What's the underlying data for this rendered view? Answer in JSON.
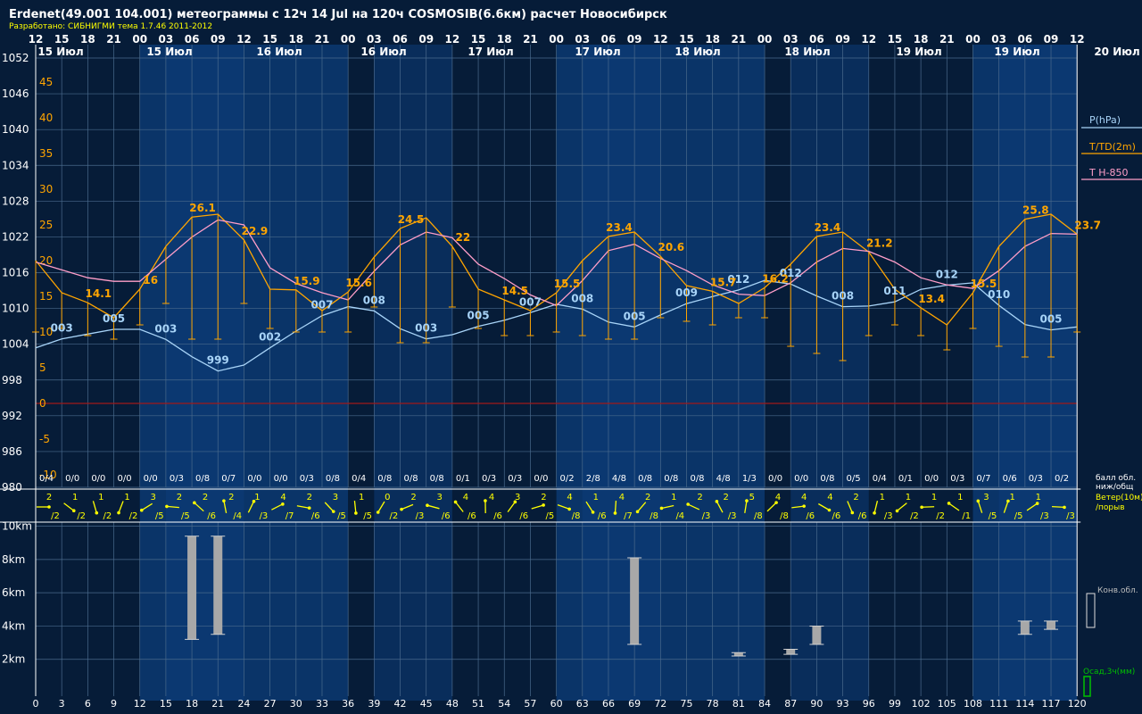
{
  "header": {
    "title": "Erdenet(49.001 104.001) метеограммы с  12ч 14 Jul на 120ч COSMOSIB(6.6км) расчет Новосибирск",
    "credit": "Разработано: СИБНИГМИ тема 1.7.46 2011-2012"
  },
  "colors": {
    "background": "#061c38",
    "band_dark": "#061c38",
    "band_light": "#0a3468",
    "grid": "#4a6a8c",
    "title": "#ffffff",
    "credit": "#ffff00",
    "pressure": "#a8d4f8",
    "temperature": "#ffa500",
    "t850": "#ff9ec8",
    "wind": "#ffff00",
    "convective_cloud": "#a8a8a8",
    "precip": "#00c000",
    "zero_line": "#a01818"
  },
  "time_axis": {
    "top_hours": [
      "12",
      "15",
      "18",
      "21",
      "00",
      "03",
      "06",
      "09",
      "12",
      "15",
      "18",
      "21",
      "00",
      "03",
      "06",
      "09",
      "12",
      "15",
      "18",
      "21",
      "00",
      "03",
      "06",
      "09",
      "12",
      "15",
      "18",
      "21",
      "00",
      "03",
      "06",
      "09",
      "12",
      "15",
      "18",
      "21",
      "00",
      "03",
      "06",
      "09",
      "12"
    ],
    "date_labels": [
      "15 Июл",
      "15 Июл",
      "16 Июл",
      "16 Июл",
      "17 Июл",
      "17 Июл",
      "18 Июл",
      "18 Июл",
      "19 Июл",
      "19 Июл",
      "20 Июл"
    ],
    "bottom_hours": [
      "0",
      "3",
      "6",
      "9",
      "12",
      "15",
      "18",
      "21",
      "24",
      "27",
      "30",
      "33",
      "36",
      "39",
      "42",
      "45",
      "48",
      "51",
      "54",
      "57",
      "60",
      "63",
      "66",
      "69",
      "72",
      "75",
      "78",
      "81",
      "84",
      "87",
      "90",
      "93",
      "96",
      "99",
      "102",
      "105",
      "108",
      "111",
      "114",
      "117",
      "120"
    ]
  },
  "y_axes": {
    "pressure_ticks": [
      "1052",
      "1046",
      "1040",
      "1034",
      "1028",
      "1022",
      "1016",
      "1010",
      "1004",
      "998",
      "992",
      "986",
      "980"
    ],
    "temperature_ticks": [
      "45",
      "40",
      "35",
      "30",
      "25",
      "20",
      "15",
      "10",
      "5",
      "0",
      "-5",
      "-10"
    ],
    "height_ticks": [
      "10km",
      "8km",
      "6km",
      "4km",
      "2km"
    ]
  },
  "legend": {
    "pressure": "P(hPa)",
    "temperature": "T/TD(2m)",
    "t850": "T H-850",
    "cloud_label_1": "балл обл.",
    "cloud_label_2": "ниж/общ",
    "wind_label_1": "Ветер(10м)",
    "wind_label_2": "/порыв",
    "convective": "Конв.обл.",
    "precip": "Осад,3ч(мм)"
  },
  "cloud_cover": [
    "0/4",
    "0/0",
    "0/0",
    "0/0",
    "0/0",
    "0/3",
    "0/8",
    "0/7",
    "0/0",
    "0/0",
    "0/3",
    "0/8",
    "0/4",
    "0/8",
    "0/8",
    "0/8",
    "0/1",
    "0/3",
    "0/3",
    "0/0",
    "0/2",
    "2/8",
    "4/8",
    "0/8",
    "0/8",
    "0/8",
    "4/8",
    "1/3",
    "0/0",
    "0/0",
    "0/8",
    "0/5",
    "0/4",
    "0/1",
    "0/0",
    "0/3",
    "0/7",
    "0/6",
    "0/3",
    "0/2"
  ],
  "wind": {
    "speeds": [
      "2",
      "1",
      "1",
      "1",
      "3",
      "2",
      "2",
      "2",
      "1",
      "4",
      "2",
      "3",
      "1",
      "0",
      "2",
      "3",
      "4",
      "4",
      "3",
      "2",
      "4",
      "1",
      "4",
      "2",
      "1",
      "2",
      "2",
      "5",
      "4",
      "4",
      "4",
      "2",
      "1",
      "1",
      "1",
      "1",
      "3",
      "1",
      "1"
    ],
    "gusts": [
      "/2",
      "/2",
      "/2",
      "/2",
      "/5",
      "/5",
      "/6",
      "/4",
      "/3",
      "/7",
      "/6",
      "/5",
      "/5",
      "/2",
      "/3",
      "/6",
      "/6",
      "/6",
      "/6",
      "/5",
      "/8",
      "/6",
      "/7",
      "/8",
      "/4",
      "/3",
      "/3",
      "/8",
      "/8",
      "/6",
      "/6",
      "/6",
      "/3",
      "/2",
      "/2",
      "/1",
      "/5",
      "/5",
      "/3",
      "/3"
    ]
  },
  "chart_data": {
    "type": "line",
    "x_hours": [
      0,
      3,
      6,
      9,
      12,
      15,
      18,
      21,
      24,
      27,
      30,
      33,
      36,
      39,
      42,
      45,
      48,
      51,
      54,
      57,
      60,
      63,
      66,
      69,
      72,
      75,
      78,
      81,
      84,
      87,
      90,
      93,
      96,
      99,
      102,
      105,
      108,
      111,
      114,
      117,
      120
    ],
    "series": [
      {
        "name": "P(hPa)",
        "axis": "pressure",
        "values": [
          1003.4,
          1004.9,
          1005.7,
          1006.5,
          1006.5,
          1004.8,
          1001.9,
          999.5,
          1000.5,
          1003.4,
          1006.2,
          1008.8,
          1010.3,
          1009.6,
          1006.6,
          1004.9,
          1005.6,
          1007.0,
          1008.0,
          1009.3,
          1010.7,
          1009.9,
          1007.7,
          1006.9,
          1008.9,
          1010.8,
          1012.0,
          1013.1,
          1014.7,
          1014.1,
          1012.1,
          1010.3,
          1010.4,
          1011.1,
          1013.2,
          1013.9,
          1014.3,
          1010.5,
          1007.3,
          1006.4,
          1006.9
        ]
      },
      {
        "name": "T/TD(2m)",
        "axis": "temperature",
        "values": [
          20,
          15.5,
          14.1,
          12,
          16,
          22,
          26.1,
          26.5,
          22.9,
          16,
          15.9,
          13,
          15.6,
          20.5,
          24.5,
          26,
          22,
          16,
          14.5,
          13,
          15.5,
          20,
          23.4,
          24,
          20.6,
          16.5,
          15.7,
          14,
          16.2,
          19.5,
          23.4,
          24,
          21.2,
          16,
          13.4,
          11,
          15.5,
          22,
          25.8,
          26.5,
          23.7
        ]
      },
      {
        "name": "T H-850",
        "axis": "temperature",
        "values": [
          19.8,
          18.7,
          17.6,
          17.1,
          17.1,
          20.2,
          23.3,
          25.7,
          25.0,
          19.0,
          16.8,
          15.5,
          14.5,
          18.5,
          22.2,
          24.0,
          23.2,
          19.5,
          17.5,
          15.2,
          13.7,
          17.2,
          21.4,
          22.3,
          20.3,
          18.6,
          16.6,
          15.3,
          15.1,
          16.9,
          19.8,
          21.7,
          21.3,
          19.8,
          17.6,
          16.6,
          16.1,
          18.6,
          22.0,
          23.8,
          23.7
        ]
      }
    ],
    "dewpoint_whiskers": [
      {
        "hour": 0,
        "t": 20,
        "td": 10
      },
      {
        "hour": 3,
        "t": 15.5,
        "td": 10.5
      },
      {
        "hour": 6,
        "t": 14.1,
        "td": 9.5
      },
      {
        "hour": 9,
        "t": 12,
        "td": 9
      },
      {
        "hour": 12,
        "t": 16,
        "td": 11
      },
      {
        "hour": 15,
        "t": 22,
        "td": 14
      },
      {
        "hour": 18,
        "t": 26.1,
        "td": 9
      },
      {
        "hour": 21,
        "t": 26.5,
        "td": 9
      },
      {
        "hour": 24,
        "t": 22.9,
        "td": 14
      },
      {
        "hour": 27,
        "t": 16,
        "td": 10.5
      },
      {
        "hour": 30,
        "t": 15.9,
        "td": 10
      },
      {
        "hour": 33,
        "t": 13,
        "td": 10
      },
      {
        "hour": 36,
        "t": 15.6,
        "td": 10
      },
      {
        "hour": 39,
        "t": 20.5,
        "td": 13.5
      },
      {
        "hour": 42,
        "t": 24.5,
        "td": 8.5
      },
      {
        "hour": 45,
        "t": 26,
        "td": 8.5
      },
      {
        "hour": 48,
        "t": 22,
        "td": 13.5
      },
      {
        "hour": 51,
        "t": 16,
        "td": 10.5
      },
      {
        "hour": 54,
        "t": 14.5,
        "td": 9.5
      },
      {
        "hour": 57,
        "t": 13,
        "td": 9.5
      },
      {
        "hour": 60,
        "t": 15.5,
        "td": 10
      },
      {
        "hour": 63,
        "t": 20,
        "td": 9.5
      },
      {
        "hour": 66,
        "t": 23.4,
        "td": 9
      },
      {
        "hour": 69,
        "t": 24,
        "td": 9
      },
      {
        "hour": 72,
        "t": 20.6,
        "td": 12
      },
      {
        "hour": 75,
        "t": 16.5,
        "td": 11.5
      },
      {
        "hour": 78,
        "t": 15.7,
        "td": 11
      },
      {
        "hour": 81,
        "t": 14,
        "td": 12
      },
      {
        "hour": 84,
        "t": 16.2,
        "td": 12
      },
      {
        "hour": 87,
        "t": 19.5,
        "td": 8
      },
      {
        "hour": 90,
        "t": 23.4,
        "td": 7
      },
      {
        "hour": 93,
        "t": 24,
        "td": 6
      },
      {
        "hour": 96,
        "t": 21.2,
        "td": 9.5
      },
      {
        "hour": 99,
        "t": 16,
        "td": 11
      },
      {
        "hour": 102,
        "t": 13.4,
        "td": 9.5
      },
      {
        "hour": 105,
        "t": 11,
        "td": 7.5
      },
      {
        "hour": 108,
        "t": 15.5,
        "td": 10.5
      },
      {
        "hour": 111,
        "t": 22,
        "td": 8
      },
      {
        "hour": 114,
        "t": 25.8,
        "td": 6.5
      },
      {
        "hour": 117,
        "t": 26.5,
        "td": 6.5
      },
      {
        "hour": 120,
        "t": 23.7,
        "td": 10
      }
    ],
    "pressure_labels": [
      {
        "hour": 3,
        "text": "003"
      },
      {
        "hour": 9,
        "text": "005"
      },
      {
        "hour": 15,
        "text": "003"
      },
      {
        "hour": 21,
        "text": "999"
      },
      {
        "hour": 27,
        "text": "002"
      },
      {
        "hour": 33,
        "text": "007"
      },
      {
        "hour": 39,
        "text": "008"
      },
      {
        "hour": 45,
        "text": "003"
      },
      {
        "hour": 51,
        "text": "005"
      },
      {
        "hour": 57,
        "text": "007"
      },
      {
        "hour": 63,
        "text": "008"
      },
      {
        "hour": 69,
        "text": "005"
      },
      {
        "hour": 75,
        "text": "009"
      },
      {
        "hour": 81,
        "text": "012"
      },
      {
        "hour": 87,
        "text": "012"
      },
      {
        "hour": 93,
        "text": "008"
      },
      {
        "hour": 99,
        "text": "011"
      },
      {
        "hour": 105,
        "text": "012"
      },
      {
        "hour": 111,
        "text": "010"
      },
      {
        "hour": 117,
        "text": "005"
      }
    ],
    "temperature_labels": [
      {
        "hour": 6,
        "text": "14.1"
      },
      {
        "hour": 12,
        "text": "16"
      },
      {
        "hour": 18,
        "text": "26.1"
      },
      {
        "hour": 24,
        "text": "22.9"
      },
      {
        "hour": 30,
        "text": "15.9"
      },
      {
        "hour": 36,
        "text": "15.6"
      },
      {
        "hour": 42,
        "text": "24.5"
      },
      {
        "hour": 48,
        "text": "22"
      },
      {
        "hour": 54,
        "text": "14.5"
      },
      {
        "hour": 60,
        "text": "15.5"
      },
      {
        "hour": 66,
        "text": "23.4"
      },
      {
        "hour": 72,
        "text": "20.6"
      },
      {
        "hour": 78,
        "text": "15.7"
      },
      {
        "hour": 84,
        "text": "16.2"
      },
      {
        "hour": 90,
        "text": "23.4"
      },
      {
        "hour": 96,
        "text": "21.2"
      },
      {
        "hour": 102,
        "text": "13.4"
      },
      {
        "hour": 108,
        "text": "15.5"
      },
      {
        "hour": 114,
        "text": "25.8"
      },
      {
        "hour": 120,
        "text": "23.7"
      }
    ],
    "convective_clouds_km": [
      {
        "hour": 18,
        "base": 3.2,
        "top": 9.4
      },
      {
        "hour": 21,
        "base": 3.5,
        "top": 9.4
      },
      {
        "hour": 69,
        "base": 2.9,
        "top": 8.1
      },
      {
        "hour": 81,
        "base": 2.2,
        "top": 2.4
      },
      {
        "hour": 87,
        "base": 2.3,
        "top": 2.6
      },
      {
        "hour": 90,
        "base": 2.9,
        "top": 4.0
      },
      {
        "hour": 114,
        "base": 3.5,
        "top": 4.3
      },
      {
        "hour": 117,
        "base": 3.8,
        "top": 4.3
      }
    ],
    "pressure_range": [
      980,
      1052
    ],
    "temperature_range": [
      -12,
      47
    ],
    "height_range_km": [
      0,
      10
    ]
  }
}
